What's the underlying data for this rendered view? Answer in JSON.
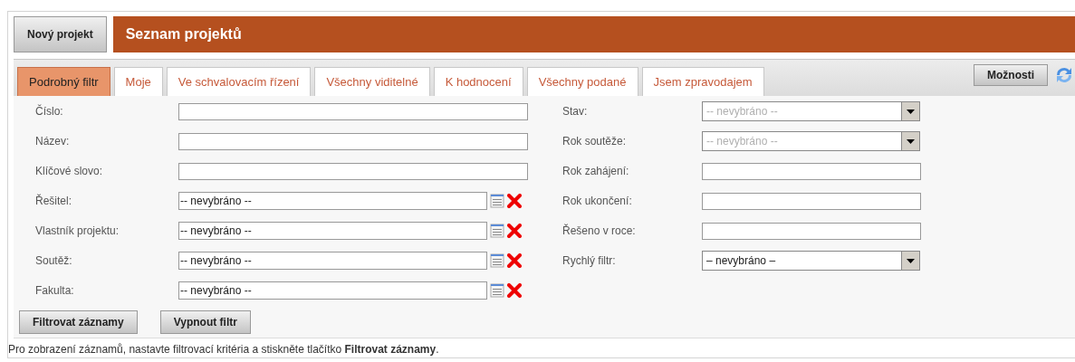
{
  "new_project_button": "Nový projekt",
  "title": "Seznam projektů",
  "tabs": [
    {
      "label": "Podrobný filtr",
      "selected": true
    },
    {
      "label": "Moje",
      "selected": false
    },
    {
      "label": "Ve schvalovacím řízení",
      "selected": false
    },
    {
      "label": "Všechny viditelné",
      "selected": false
    },
    {
      "label": "K hodnocení",
      "selected": false
    },
    {
      "label": "Všechny podané",
      "selected": false
    },
    {
      "label": "Jsem zpravodajem",
      "selected": false
    }
  ],
  "options_button": "Možnosti",
  "left_fields": [
    {
      "label": "Číslo:",
      "kind": "text"
    },
    {
      "label": "Název:",
      "kind": "text"
    },
    {
      "label": "Klíčové slovo:",
      "kind": "text"
    },
    {
      "label": "Řešitel:",
      "kind": "picker",
      "value": "-- nevybráno --"
    },
    {
      "label": "Vlastník projektu:",
      "kind": "picker",
      "value": "-- nevybráno --"
    },
    {
      "label": "Soutěž:",
      "kind": "picker",
      "value": "-- nevybráno --"
    },
    {
      "label": "Fakulta:",
      "kind": "picker",
      "value": "-- nevybráno --"
    }
  ],
  "right_fields": [
    {
      "label": "Stav:",
      "kind": "select",
      "value": "-- nevybráno --",
      "disabled": true
    },
    {
      "label": "Rok soutěže:",
      "kind": "select",
      "value": "-- nevybráno --",
      "disabled": true
    },
    {
      "label": "Rok zahájení:",
      "kind": "text"
    },
    {
      "label": "Rok ukončení:",
      "kind": "text"
    },
    {
      "label": "Řešeno v roce:",
      "kind": "text"
    },
    {
      "label": "Rychlý filtr:",
      "kind": "select",
      "value": "– nevybráno –",
      "disabled": false
    }
  ],
  "actions": [
    "Filtrovat záznamy",
    "Vypnout filtr"
  ],
  "hint": "Pro zobrazení záznamů, nastavte filtrovací kritéria a stiskněte tlačítko **Filtrovat záznamy**."
}
